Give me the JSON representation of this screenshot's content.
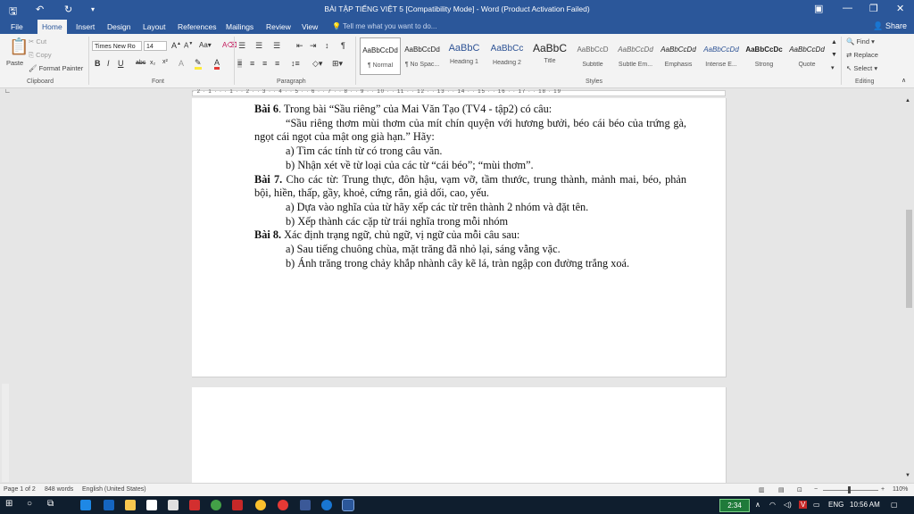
{
  "window": {
    "title": "BÀI TẬP TIẾNG VIỆT 5 [Compatibility Mode] - Word (Product Activation Failed)",
    "share_label": "Share"
  },
  "tabs": [
    "File",
    "Home",
    "Insert",
    "Design",
    "Layout",
    "References",
    "Mailings",
    "Review",
    "View"
  ],
  "tell_me_placeholder": "Tell me what you want to do...",
  "ribbon": {
    "clipboard": {
      "paste": "Paste",
      "cut": "Cut",
      "copy": "Copy",
      "format_painter": "Format Painter",
      "label": "Clipboard"
    },
    "font": {
      "family": "Times New Ro",
      "size": "14",
      "label": "Font"
    },
    "paragraph_label": "Paragraph",
    "styles_label": "Styles",
    "styles": [
      {
        "sample": "AaBbCcDd",
        "name": "¶ Normal"
      },
      {
        "sample": "AaBbCcDd",
        "name": "¶ No Spac..."
      },
      {
        "sample": "AaBbC",
        "name": "Heading 1"
      },
      {
        "sample": "AaBbCc",
        "name": "Heading 2"
      },
      {
        "sample": "AaBbC",
        "name": "Title"
      },
      {
        "sample": "AaBbCcD",
        "name": "Subtitle"
      },
      {
        "sample": "AaBbCcDd",
        "name": "Subtle Em..."
      },
      {
        "sample": "AaBbCcDd",
        "name": "Emphasis"
      },
      {
        "sample": "AaBbCcDd",
        "name": "Intense E..."
      },
      {
        "sample": "AaBbCcDc",
        "name": "Strong"
      },
      {
        "sample": "AaBbCcDd",
        "name": "Quote"
      }
    ],
    "editing": {
      "find": "Find",
      "replace": "Replace",
      "select": "Select",
      "label": "Editing"
    }
  },
  "ruler_text": "· 2 · 1 · · · 1 · · 2 · · 3 · · 4 · · 5 · · 6 · · 7 · · 8 · · 9 · · 10 · · 11 · · 12 · · 13 · · 14 · · 15 · · 16 · · 17 · · 18 · 19",
  "document": {
    "bai6_title": "Bài 6",
    "bai6_text": ". Trong bài “Sầu riêng” của Mai Văn Tạo (TV4 - tập2) có câu:",
    "quote": "“Sầu riêng thơm mùi thơm của mít chín quyện với hương bưởi, béo cái béo của trứng gà, ngọt cái ngọt của mật ong già hạn.” Hãy:",
    "bai6_a": "a) Tìm các tính từ có trong câu văn.",
    "bai6_b": "b) Nhận xét về từ loại của các từ “cái béo”; “mùi thơm”.",
    "bai7_title": "Bài 7.",
    "bai7_text": " Cho các từ: Trung thực, đôn hậu, vạm vỡ, tầm thước, trung thành, mảnh mai, béo, phản bội, hiền, thấp, gầy, khoẻ, cứng rắn, giả dối, cao, yếu.",
    "bai7_a": "a) Dựa vào nghĩa của từ hãy xếp các từ trên thành 2 nhóm và đặt tên.",
    "bai7_b": "b) Xếp thành các cặp từ trái nghĩa trong mỗi nhóm",
    "bai8_title": "Bài 8.",
    "bai8_text": " Xác định trạng ngữ, chủ ngữ, vị ngữ của mỗi câu sau:",
    "bai8_a": "a) Sau tiếng chuông chùa, mặt trăng đã nhỏ lại, sáng vằng vặc.",
    "bai8_b": "b) Ánh trăng trong chảy khắp nhành cây kẽ lá, tràn ngập con đường trắng xoá."
  },
  "status": {
    "page": "Page 1 of 2",
    "words": "848 words",
    "language": "English (United States)",
    "zoom": "110%"
  },
  "taskbar": {
    "badge": "2:34",
    "lang": "ENG",
    "time": "10:56 AM"
  }
}
